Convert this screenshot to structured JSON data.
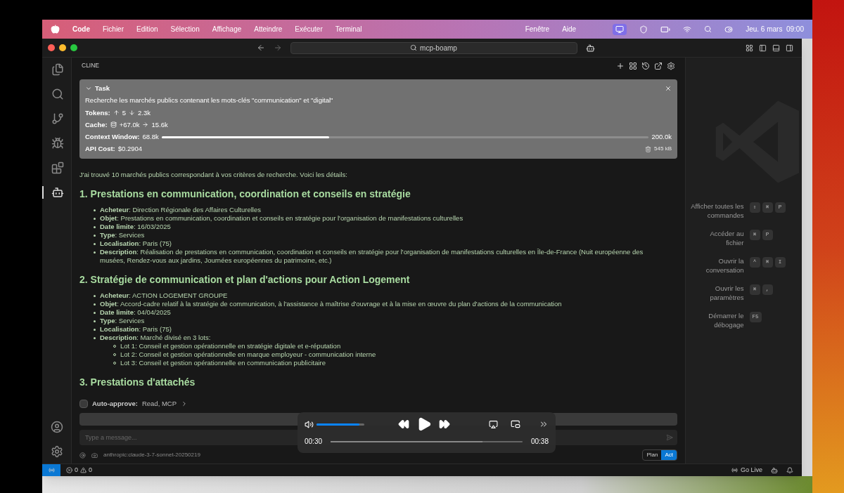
{
  "menubar": {
    "app": "Code",
    "menus": [
      "Fichier",
      "Edition",
      "Sélection",
      "Affichage",
      "Atteindre",
      "Exécuter",
      "Terminal"
    ],
    "right_menus": [
      "Fenêtre",
      "Aide"
    ],
    "clock": "Jeu. 6 mars  09:00"
  },
  "window": {
    "search": "mcp-boamp"
  },
  "activity_bar": [
    {
      "kind": "files",
      "selected": false
    },
    {
      "kind": "search",
      "selected": false
    },
    {
      "kind": "git",
      "selected": false
    },
    {
      "kind": "debug",
      "selected": false
    },
    {
      "kind": "extensions",
      "selected": false
    },
    {
      "kind": "bot",
      "selected": true
    }
  ],
  "panel": {
    "title": "CLINE",
    "task": {
      "label": "Task",
      "prompt": "Recherche les marchés publics contenant les mots-clés \"communication\" et \"digital\"",
      "tokens_label": "Tokens:",
      "tokens_in": "5",
      "tokens_out": "2.3k",
      "cache_label": "Cache:",
      "cache_write": "+67.0k",
      "cache_read": "15.6k",
      "context": {
        "label": "Context Window:",
        "used": "68.8k",
        "level": 0.344,
        "max": "200.0k"
      },
      "cost_label": "API Cost:",
      "cost": "$0.2904",
      "size": "545 kB"
    },
    "intro": "J'ai trouvé 10 marchés publics correspondant à vos critères de recherche. Voici les détails:",
    "sections": [
      {
        "heading": "1. Prestations en communication, coordination et conseils en stratégie",
        "items": [
          {
            "text": "**Acheteur**: Direction Régionale des Affaires Culturelles"
          },
          {
            "text": "**Objet**: Prestations en communication, coordination et conseils en stratégie pour l'organisation de manifestations culturelles"
          },
          {
            "text": "**Date limite**: 16/03/2025"
          },
          {
            "text": "**Type**: Services"
          },
          {
            "text": "**Localisation**: Paris (75)"
          },
          {
            "text": "**Description**: Réalisation de prestations en communication, coordination et conseils en stratégie pour l'organisation de manifestations culturelles en Île-de-France (Nuit européenne des musées, Rendez-vous aux jardins, Journées européennes du patrimoine, etc.)"
          }
        ]
      },
      {
        "heading": "2. Stratégie de communication et plan d'actions pour Action Logement",
        "items": [
          {
            "text": "**Acheteur**: ACTION LOGEMENT GROUPE"
          },
          {
            "text": "**Objet**: Accord-cadre relatif à la stratégie de communication, à l'assistance à maîtrise d'ouvrage et à la mise en œuvre du plan d'actions de la communication"
          },
          {
            "text": "**Date limite**: 04/04/2025"
          },
          {
            "text": "**Type**: Services"
          },
          {
            "text": "**Localisation**: Paris (75)"
          },
          {
            "text": "**Description**: Marché divisé en 3 lots:",
            "children": [
              "Lot 1: Conseil et gestion opérationnelle en stratégie digitale et e-réputation",
              "Lot 2: Conseil et gestion opérationnelle en marque employeur - communication interne",
              "Lot 3: Conseil et gestion opérationnelle en communication publicitaire"
            ]
          }
        ]
      },
      {
        "heading": "3. Prestations d'attachés"
      }
    ],
    "auto_approve": {
      "label": "Auto-approve:",
      "value": "Read, MCP",
      "checked": false
    },
    "input": {
      "placeholder": "Type a message..."
    },
    "model": "anthropic:claude-3-7-sonnet-20250219",
    "modes": [
      {
        "label": "Plan",
        "selected": false
      },
      {
        "label": "Act",
        "selected": true
      }
    ]
  },
  "shortcuts": [
    {
      "label": "Afficher toutes les commandes",
      "keys": [
        "⇧",
        "⌘",
        "P"
      ]
    },
    {
      "label": "Accéder au fichier",
      "keys": [
        "⌘",
        "P"
      ]
    },
    {
      "label": "Ouvrir la conversation",
      "keys": [
        "^",
        "⌘",
        "I"
      ]
    },
    {
      "label": "Ouvrir les paramètres",
      "keys": [
        "⌘",
        ","
      ]
    },
    {
      "label": "Démarrer le débogage",
      "keys": [
        "F5"
      ]
    }
  ],
  "status_bar": {
    "errors": "0",
    "warnings": "0",
    "go_live": "Go Live"
  },
  "video": {
    "volume": {
      "level": 0.9
    },
    "elapsed": "00:30",
    "progress": {
      "level": 0.79
    },
    "total": "00:38"
  }
}
